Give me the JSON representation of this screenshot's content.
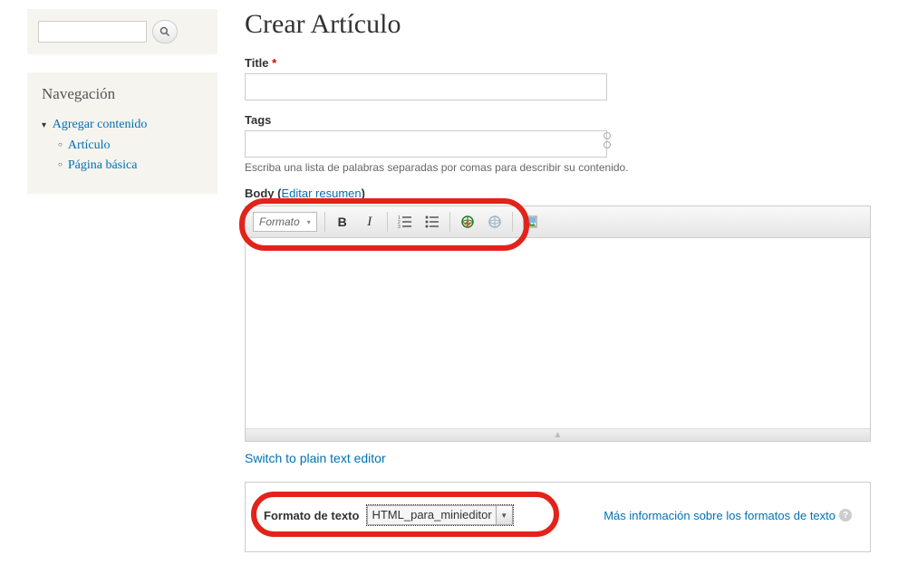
{
  "sidebar": {
    "nav_title": "Navegación",
    "parent_link": "Agregar contenido",
    "items": [
      {
        "label": "Artículo"
      },
      {
        "label": "Página básica"
      }
    ]
  },
  "page": {
    "title": "Crear Artículo"
  },
  "fields": {
    "title_label": "Title",
    "required_marker": "*",
    "tags_label": "Tags",
    "tags_help": "Escriba una lista de palabras separadas por comas para describir su contenido.",
    "body_label": "Body",
    "edit_summary": "Editar resumen"
  },
  "toolbar": {
    "format_label": "Formato",
    "bold": "B",
    "italic": "I"
  },
  "editor": {
    "switch_link": "Switch to plain text editor"
  },
  "text_format": {
    "label": "Formato de texto",
    "selected": "HTML_para_minieditor",
    "more_info": "Más información sobre los formatos de texto"
  }
}
